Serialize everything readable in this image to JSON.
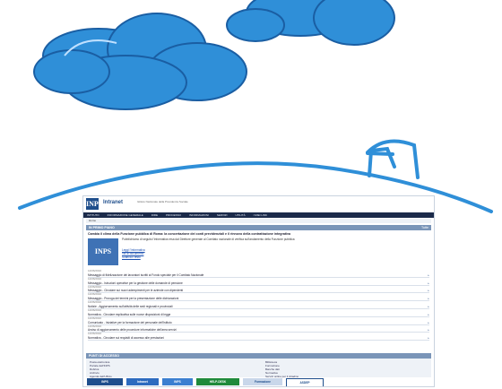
{
  "colors": {
    "cloud_fill": "#2f8fd8",
    "cloud_outline": "#1a5ea3",
    "roof_stroke": "#2f8fd8"
  },
  "site": {
    "logo": "INPS",
    "brand": "Intranet",
    "subtitle": "Istituto Nazionale della Previdenza Sociale",
    "nav": [
      "ISTITUTO",
      "INFORMAZIONE GENERALE",
      "DIRE",
      "PROCESSO",
      "INFORMAZIONI",
      "SERVIZI",
      "UTILITÀ",
      "I MIEI LINK"
    ],
    "breadcrumb": "Home",
    "section_title": "IN PRIMO PIANO",
    "section_cta": "Tutte",
    "headline": "Cambia il clima della Funzione pubblica di Roma: la concertazione dei conti previdenziali e il rinnovo della contrattazione integrativa",
    "thumb": "INPS",
    "paragraph": "Pubblichiamo di seguito l'informativa resa dal Direttore generale al Comitato nazionale di verifica sull'andamento della Funzione pubblica",
    "links": [
      "Leggi l'informativa",
      "Vai al documento",
      "Scarica il testo"
    ],
    "news": [
      {
        "date": "14/06/2010",
        "title": "Messaggio di fidelizzazione dei lavoratori iscritti al Fondo speciale per il Comitato Nazionale"
      },
      {
        "date": "14/06/2010",
        "title": "Messaggio - Istruzioni operative per la gestione delle domande di pensione"
      },
      {
        "date": "14/06/2010",
        "title": "Messaggio - Circolare sui nuovi adempimenti per le aziende con dipendenti"
      },
      {
        "date": "14/06/2010",
        "title": "Messaggio - Proroga dei termini per la presentazione delle dichiarazioni"
      },
      {
        "date": "14/06/2010",
        "title": "Notizie - Aggiornamento sull'attività delle sedi regionali e provinciali"
      },
      {
        "date": "14/06/2010",
        "title": "Normativa - Circolare esplicativa sulle nuove disposizioni di legge"
      },
      {
        "date": "14/06/2010",
        "title": "Comunicato - Iniziative per la formazione del personale dell'Istituto"
      },
      {
        "date": "14/06/2010",
        "title": "Avviso di aggiornamento delle procedure informatiche dell'area servizi"
      },
      {
        "date": "14/06/2010",
        "title": "Normativa - Circolare sui requisiti di accesso alle prestazioni"
      }
    ],
    "quick_title": "PUNTI DI ACCESSO",
    "quick_left": [
      "Posta elettronica",
      "Portale dell'INPS",
      "Rubrica",
      "Archivio",
      "Agenda dell'Ufficio",
      "Modulistica"
    ],
    "quick_right": [
      "Biblioteca",
      "Formazione",
      "Banche dati",
      "Normativa",
      "Servizi online per il cittadino"
    ],
    "footer_badges": [
      "INPS",
      "Intranet",
      "INPS",
      "HELP-DESK",
      "Formazione",
      "ASDEP"
    ]
  }
}
